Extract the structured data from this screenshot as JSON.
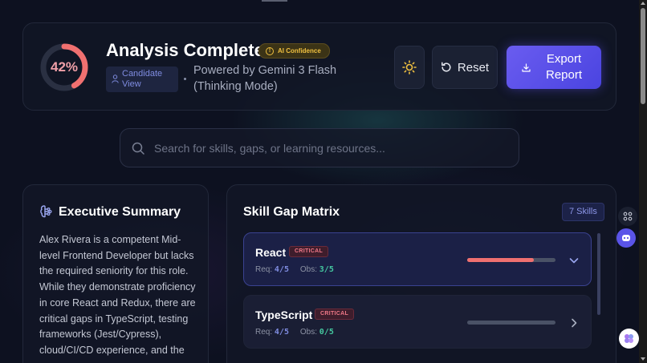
{
  "header": {
    "score_label": "42%",
    "score_value": 0.42,
    "title": "Analysis Complete",
    "confidence_badge": "AI Confidence",
    "candidate_view": "Candidate View",
    "powered_by": "Powered by Gemini 3 Flash (Thinking Mode)",
    "reset_label": "Reset",
    "export_label": "Export Report"
  },
  "search": {
    "placeholder": "Search for skills, gaps, or learning resources..."
  },
  "executive_summary": {
    "title": "Executive Summary",
    "text": "Alex Rivera is a competent Mid-level Frontend Developer but lacks the required seniority for this role. While they demonstrate proficiency in core React and Redux, there are critical gaps in TypeScript, testing frameworks (Jest/Cypress), cloud/CI/CD experience, and the"
  },
  "skill_matrix": {
    "title": "Skill Gap Matrix",
    "count_label": "7 Skills",
    "req_prefix": "Req:",
    "obs_prefix": "Obs:",
    "skills": [
      {
        "name": "React",
        "badge": "CRITICAL",
        "req": "4/5",
        "obs": "3/5",
        "fill": 0.75,
        "expanded": true
      },
      {
        "name": "TypeScript",
        "badge": "CRITICAL",
        "req": "4/5",
        "obs": "0/5",
        "fill": 0.0,
        "expanded": false
      }
    ]
  },
  "colors": {
    "accent": "#5a54e8",
    "critical": "#f07888",
    "score": "#f07070",
    "confidence": "#f0c040",
    "observed": "#45c8a0"
  }
}
